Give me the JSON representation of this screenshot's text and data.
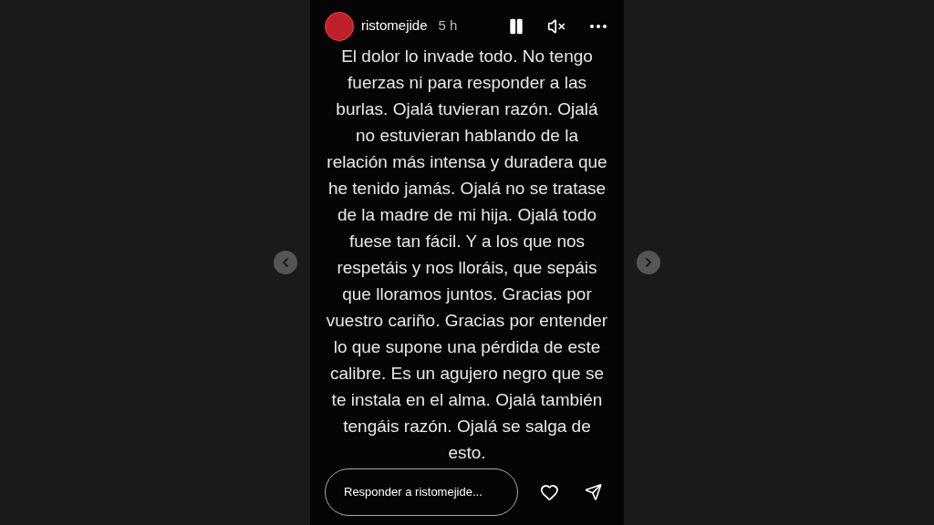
{
  "story": {
    "username": "ristomejide",
    "time": "5 h",
    "text": "El dolor lo invade todo. No tengo fuerzas ni para responder a las burlas. Ojalá tuvieran razón. Ojalá no estuvieran hablando de la relación más intensa y duradera que he tenido jamás. Ojalá no se tratase de la madre de mi hija. Ojalá todo fuese tan fácil. Y a los que nos respetáis y nos lloráis, que sepáis que lloramos juntos. Gracias por vuestro cariño. Gracias por entender lo que supone una pérdida de este calibre. Es un agujero negro que se te instala en el alma. Ojalá también tengáis razón. Ojalá se salga de esto."
  },
  "reply": {
    "placeholder": "Responder a ristomejide..."
  }
}
